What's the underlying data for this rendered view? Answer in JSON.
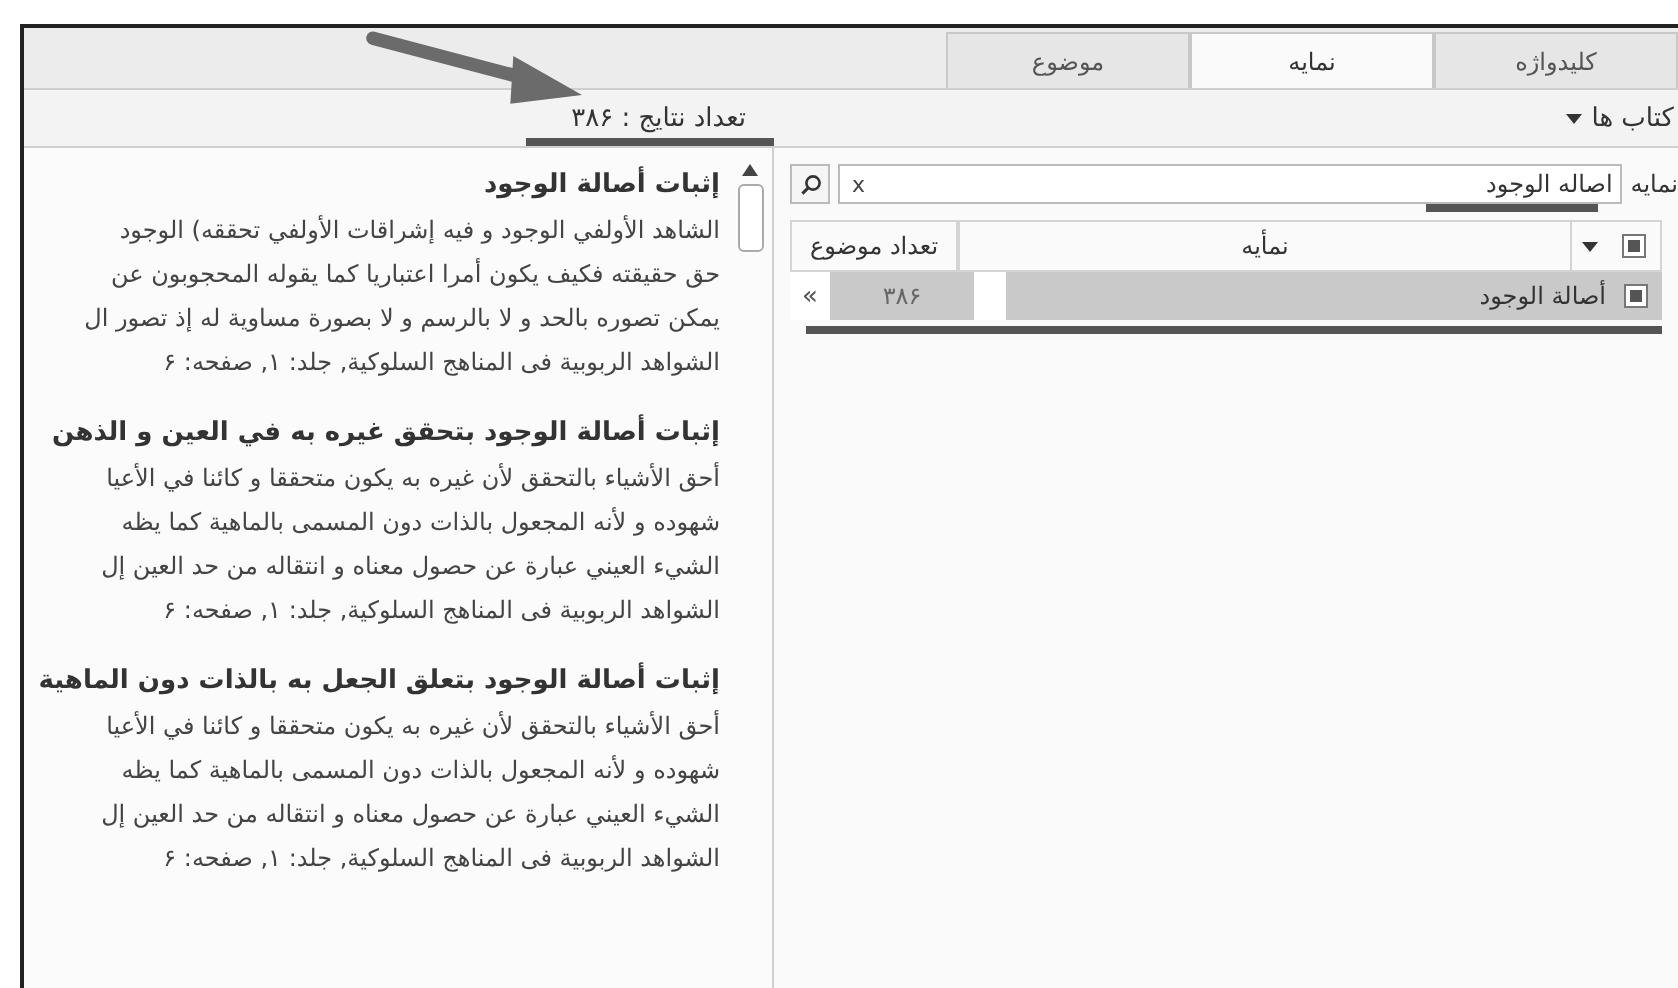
{
  "tabs": [
    {
      "label": "کلیدواژه",
      "selected": false
    },
    {
      "label": "نمایه",
      "selected": true
    },
    {
      "label": "موضوع",
      "selected": false
    }
  ],
  "books_dropdown": {
    "label": "کتاب ها"
  },
  "result_count": "تعداد نتایج : ۳۸۶",
  "search": {
    "label": "نمایه",
    "value": "اصاله الوجود",
    "clear": "x"
  },
  "table": {
    "header_checked": true,
    "columns": [
      "نمأیه",
      "تعداد موضوع"
    ],
    "rows": [
      {
        "checked": true,
        "selected": true,
        "cells": [
          "أصالة الوجود",
          "۳۸۶"
        ],
        "expand": "«"
      }
    ]
  },
  "results": [
    {
      "title": "إثبات أصالة الوجود",
      "lines": [
        "الشاهد الأولفي الوجود و فيه إشراقات الأولفي تحققه) الوجود",
        "حق حقيقته فكيف يكون أمرا اعتباريا كما يقوله المحجوبون عن",
        "يمكن تصوره بالحد و لا بالرسم و لا بصورة مساوية له إذ تصور ال",
        "الشواهد الربوبية فى المناهج السلوكية, جلد: ۱, صفحه: ۶"
      ]
    },
    {
      "title": "إثبات أصالة الوجود بتحقق غيره به في العين و الذهن",
      "lines": [
        "أحق الأشياء بالتحقق لأن غيره به يكون متحققا و كائنا في الأعيا",
        "شهوده و لأنه المجعول بالذات دون المسمى بالماهية كما يظه",
        "الشيء العيني عبارة عن حصول معناه و انتقاله من حد العين إل",
        "الشواهد الربوبية فى المناهج السلوكية, جلد: ۱, صفحه: ۶"
      ]
    },
    {
      "title": "إثبات أصالة الوجود بتعلق الجعل به بالذات دون الماهية",
      "lines": [
        "أحق الأشياء بالتحقق لأن غيره به يكون متحققا و كائنا في الأعيا",
        "شهوده و لأنه المجعول بالذات دون المسمى بالماهية كما يظه",
        "الشيء العيني عبارة عن حصول معناه و انتقاله من حد العين إل",
        "الشواهد الربوبية فى المناهج السلوكية, جلد: ۱, صفحه: ۶"
      ]
    }
  ]
}
